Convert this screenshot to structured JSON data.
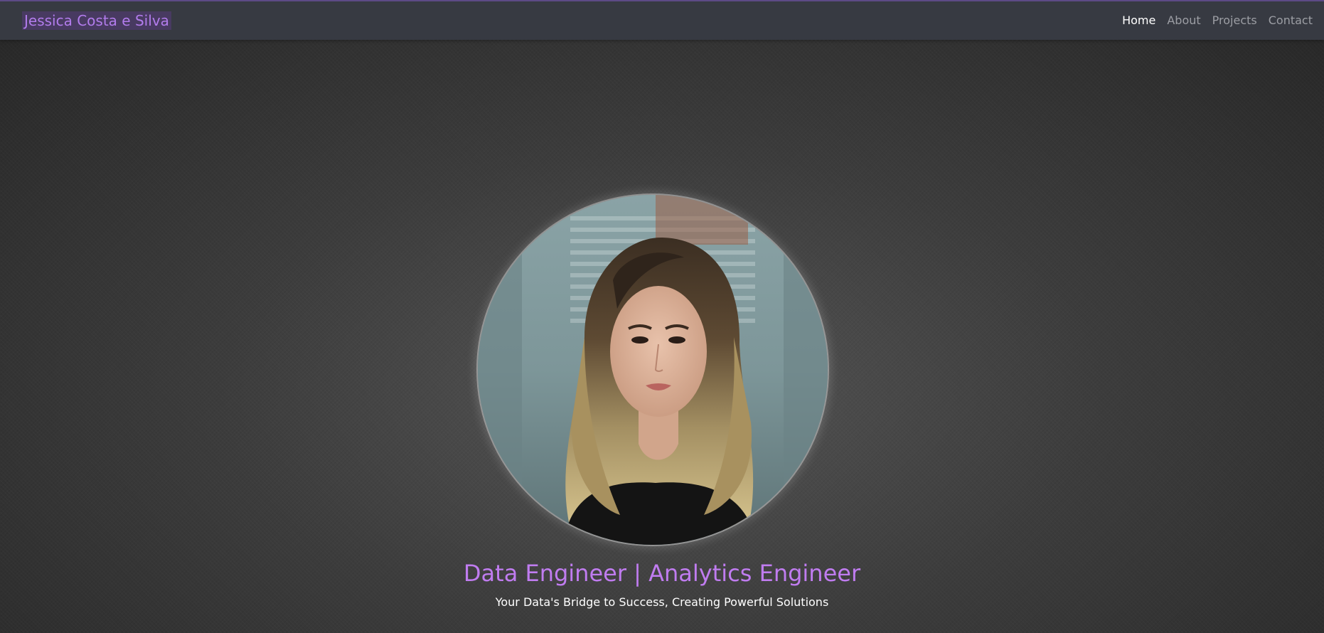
{
  "navbar": {
    "brand": "Jessica Costa e Silva",
    "links": [
      {
        "label": "Home",
        "active": true
      },
      {
        "label": "About",
        "active": false
      },
      {
        "label": "Projects",
        "active": false
      },
      {
        "label": "Contact",
        "active": false
      }
    ]
  },
  "hero": {
    "headline": "Data Engineer | Analytics Engineer",
    "tagline": "Your Data's Bridge to Success, Creating Powerful Solutions"
  },
  "colors": {
    "accent": "#c07cf0",
    "navbar_bg": "#373a42",
    "nav_link": "#9c9ea4",
    "nav_link_active": "#ffffff"
  }
}
